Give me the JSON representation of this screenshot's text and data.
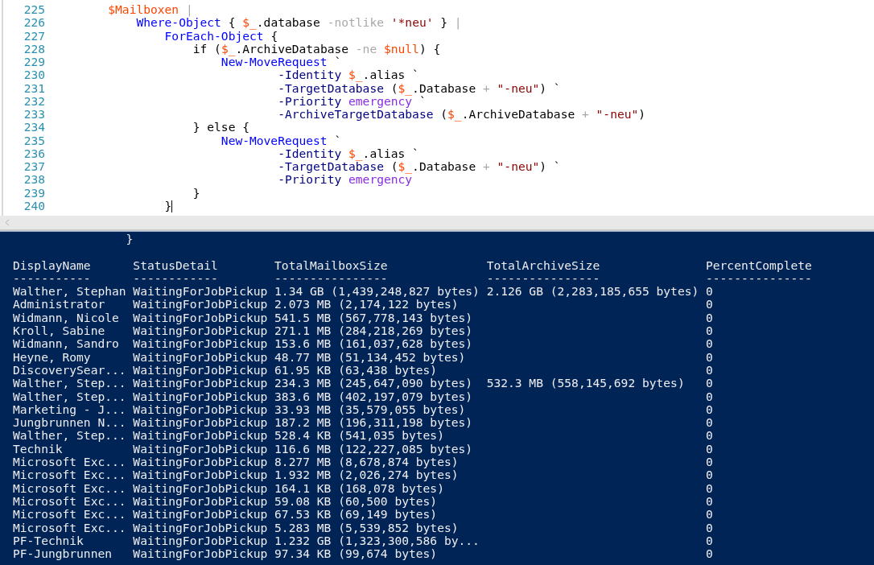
{
  "editor": {
    "lines": [
      {
        "number": "225",
        "tokens": [
          {
            "kind": "variable",
            "text": "        $Mailboxen"
          },
          {
            "kind": "operator",
            "text": " |"
          }
        ]
      },
      {
        "number": "226",
        "tokens": [
          {
            "kind": "command",
            "text": "            Where-Object"
          },
          {
            "kind": "text",
            "text": " { "
          },
          {
            "kind": "variable",
            "text": "$_"
          },
          {
            "kind": "text",
            "text": ".database "
          },
          {
            "kind": "operator",
            "text": "-notlike"
          },
          {
            "kind": "string",
            "text": " '*neu'"
          },
          {
            "kind": "text",
            "text": " } "
          },
          {
            "kind": "operator",
            "text": "|"
          }
        ]
      },
      {
        "number": "227",
        "tokens": [
          {
            "kind": "command",
            "text": "                ForEach-Object"
          },
          {
            "kind": "text",
            "text": " {"
          }
        ]
      },
      {
        "number": "228",
        "tokens": [
          {
            "kind": "text",
            "text": "                    if ("
          },
          {
            "kind": "variable",
            "text": "$_"
          },
          {
            "kind": "text",
            "text": ".ArchiveDatabase "
          },
          {
            "kind": "operator",
            "text": "-ne"
          },
          {
            "kind": "variable",
            "text": " $null"
          },
          {
            "kind": "text",
            "text": ") {"
          }
        ]
      },
      {
        "number": "229",
        "tokens": [
          {
            "kind": "command",
            "text": "                        New-MoveRequest"
          },
          {
            "kind": "text",
            "text": " `"
          }
        ]
      },
      {
        "number": "230",
        "tokens": [
          {
            "kind": "parameter",
            "text": "                                -Identity"
          },
          {
            "kind": "variable",
            "text": " $_"
          },
          {
            "kind": "text",
            "text": ".alias `"
          }
        ]
      },
      {
        "number": "231",
        "tokens": [
          {
            "kind": "parameter",
            "text": "                                -TargetDatabase"
          },
          {
            "kind": "text",
            "text": " ("
          },
          {
            "kind": "variable",
            "text": "$_"
          },
          {
            "kind": "text",
            "text": ".Database "
          },
          {
            "kind": "operator",
            "text": "+"
          },
          {
            "kind": "string",
            "text": " \"-neu\""
          },
          {
            "kind": "text",
            "text": ") `"
          }
        ]
      },
      {
        "number": "232",
        "tokens": [
          {
            "kind": "parameter",
            "text": "                                -Priority"
          },
          {
            "kind": "argument",
            "text": " emergency"
          },
          {
            "kind": "text",
            "text": " `"
          }
        ]
      },
      {
        "number": "233",
        "tokens": [
          {
            "kind": "parameter",
            "text": "                                -ArchiveTargetDatabase"
          },
          {
            "kind": "text",
            "text": " ("
          },
          {
            "kind": "variable",
            "text": "$_"
          },
          {
            "kind": "text",
            "text": ".ArchiveDatabase "
          },
          {
            "kind": "operator",
            "text": "+"
          },
          {
            "kind": "string",
            "text": " \"-neu\""
          },
          {
            "kind": "text",
            "text": ")"
          }
        ]
      },
      {
        "number": "234",
        "tokens": [
          {
            "kind": "text",
            "text": "                    } else {"
          }
        ]
      },
      {
        "number": "235",
        "tokens": [
          {
            "kind": "command",
            "text": "                        New-MoveRequest"
          },
          {
            "kind": "text",
            "text": " `"
          }
        ]
      },
      {
        "number": "236",
        "tokens": [
          {
            "kind": "parameter",
            "text": "                                -Identity"
          },
          {
            "kind": "variable",
            "text": " $_"
          },
          {
            "kind": "text",
            "text": ".alias `"
          }
        ]
      },
      {
        "number": "237",
        "tokens": [
          {
            "kind": "parameter",
            "text": "                                -TargetDatabase"
          },
          {
            "kind": "text",
            "text": " ("
          },
          {
            "kind": "variable",
            "text": "$_"
          },
          {
            "kind": "text",
            "text": ".Database "
          },
          {
            "kind": "operator",
            "text": "+"
          },
          {
            "kind": "string",
            "text": " \"-neu\""
          },
          {
            "kind": "text",
            "text": ") `"
          }
        ]
      },
      {
        "number": "238",
        "tokens": [
          {
            "kind": "parameter",
            "text": "                                -Priority"
          },
          {
            "kind": "argument",
            "text": " emergency"
          }
        ]
      },
      {
        "number": "239",
        "tokens": [
          {
            "kind": "text",
            "text": "                    }"
          }
        ]
      },
      {
        "number": "240",
        "tokens": [
          {
            "kind": "text",
            "text": "                }"
          }
        ]
      }
    ]
  },
  "console": {
    "lines": [
      "                }"
    ],
    "columns": [
      {
        "label": "DisplayName",
        "rule": "-----------"
      },
      {
        "label": "StatusDetail",
        "rule": "------------"
      },
      {
        "label": "TotalMailboxSize",
        "rule": "----------------"
      },
      {
        "label": "TotalArchiveSize",
        "rule": "----------------"
      },
      {
        "label": "PercentComplete",
        "rule": "---------------"
      }
    ],
    "rows": [
      [
        "Walther, Stephan",
        "WaitingForJobPickup",
        "1.34 GB (1,439,248,827 bytes)",
        "2.126 GB (2,283,185,655 bytes)",
        "0"
      ],
      [
        "Administrator",
        "WaitingForJobPickup",
        "2.073 MB (2,174,122 bytes)",
        "",
        "0"
      ],
      [
        "Widmann, Nicole",
        "WaitingForJobPickup",
        "541.5 MB (567,778,143 bytes)",
        "",
        "0"
      ],
      [
        "Kroll, Sabine",
        "WaitingForJobPickup",
        "271.1 MB (284,218,269 bytes)",
        "",
        "0"
      ],
      [
        "Widmann, Sandro",
        "WaitingForJobPickup",
        "153.6 MB (161,037,628 bytes)",
        "",
        "0"
      ],
      [
        "Heyne, Romy",
        "WaitingForJobPickup",
        "48.77 MB (51,134,452 bytes)",
        "",
        "0"
      ],
      [
        "DiscoverySear...",
        "WaitingForJobPickup",
        "61.95 KB (63,438 bytes)",
        "",
        "0"
      ],
      [
        "Walther, Step...",
        "WaitingForJobPickup",
        "234.3 MB (245,647,090 bytes)",
        "532.3 MB (558,145,692 bytes)",
        "0"
      ],
      [
        "Walther, Step...",
        "WaitingForJobPickup",
        "383.6 MB (402,197,079 bytes)",
        "",
        "0"
      ],
      [
        "Marketing - J...",
        "WaitingForJobPickup",
        "33.93 MB (35,579,055 bytes)",
        "",
        "0"
      ],
      [
        "Jungbrunnen N...",
        "WaitingForJobPickup",
        "187.2 MB (196,311,198 bytes)",
        "",
        "0"
      ],
      [
        "Walther, Step...",
        "WaitingForJobPickup",
        "528.4 KB (541,035 bytes)",
        "",
        "0"
      ],
      [
        "Technik",
        "WaitingForJobPickup",
        "116.6 MB (122,227,085 bytes)",
        "",
        "0"
      ],
      [
        "Microsoft Exc...",
        "WaitingForJobPickup",
        "8.277 MB (8,678,874 bytes)",
        "",
        "0"
      ],
      [
        "Microsoft Exc...",
        "WaitingForJobPickup",
        "1.932 MB (2,026,274 bytes)",
        "",
        "0"
      ],
      [
        "Microsoft Exc...",
        "WaitingForJobPickup",
        "164.1 KB (168,078 bytes)",
        "",
        "0"
      ],
      [
        "Microsoft Exc...",
        "WaitingForJobPickup",
        "59.08 KB (60,500 bytes)",
        "",
        "0"
      ],
      [
        "Microsoft Exc...",
        "WaitingForJobPickup",
        "67.53 KB (69,149 bytes)",
        "",
        "0"
      ],
      [
        "Microsoft Exc...",
        "WaitingForJobPickup",
        "5.283 MB (5,539,852 bytes)",
        "",
        "0"
      ],
      [
        "PF-Technik",
        "WaitingForJobPickup",
        "1.232 GB (1,323,300,586 by...",
        "",
        "0"
      ],
      [
        "PF-Jungbrunnen",
        "WaitingForJobPickup",
        "97.34 KB (99,674 bytes)",
        "",
        "0"
      ]
    ]
  }
}
